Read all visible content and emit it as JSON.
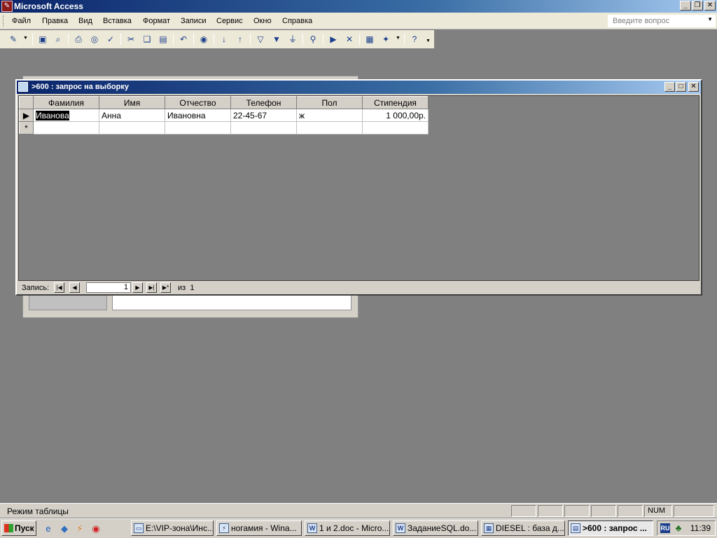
{
  "app": {
    "title": "Microsoft Access"
  },
  "menu": {
    "items": [
      "Файл",
      "Правка",
      "Вид",
      "Вставка",
      "Формат",
      "Записи",
      "Сервис",
      "Окно",
      "Справка"
    ],
    "ask_placeholder": "Введите вопрос"
  },
  "toolbar": {
    "buttons": [
      "view-icon",
      "save-icon",
      "search-file-icon",
      "print-icon",
      "print-preview-icon",
      "spelling-icon",
      "cut-icon",
      "copy-icon",
      "paste-icon",
      "undo-icon",
      "hyperlink-icon",
      "sort-ascending-icon",
      "sort-descending-icon",
      "filter-by-selection-icon",
      "filter-by-form-icon",
      "apply-filter-icon",
      "find-icon",
      "new-record-icon",
      "delete-record-icon",
      "database-window-icon",
      "new-object-icon",
      "help-icon"
    ]
  },
  "query_window": {
    "title": ">600 : запрос на выборку",
    "columns": [
      "Фамилия",
      "Имя",
      "Отчество",
      "Телефон",
      "Пол",
      "Стипендия"
    ],
    "rows": [
      {
        "surname": "Иванова",
        "name": "Анна",
        "patronymic": "Ивановна",
        "phone": "22-45-67",
        "sex": "ж",
        "stipend": "1 000,00р."
      }
    ],
    "new_row_marker": "*",
    "current_row_marker": "▶",
    "nav": {
      "label": "Запись:",
      "current": "1",
      "of_label": "из",
      "total": "1"
    }
  },
  "status_bar": {
    "mode": "Режим таблицы",
    "num": "NUM"
  },
  "taskbar": {
    "start_label": "Пуск",
    "tasks": [
      {
        "label": "E:\\VIP-зона\\Инс...",
        "icon": "folder-icon",
        "active": false
      },
      {
        "label": "ногамия - Wina...",
        "icon": "winamp-icon",
        "active": false
      },
      {
        "label": "1 и 2.doc - Micro...",
        "icon": "word-icon",
        "active": false
      },
      {
        "label": "ЗаданиеSQL.do...",
        "icon": "word-icon",
        "active": false
      },
      {
        "label": "DIESEL : база д...",
        "icon": "access-db-icon",
        "active": false
      },
      {
        "label": ">600 : запрос ...",
        "icon": "query-icon",
        "active": true
      }
    ],
    "tray": {
      "lang": "RU",
      "clock": "11:39"
    }
  }
}
